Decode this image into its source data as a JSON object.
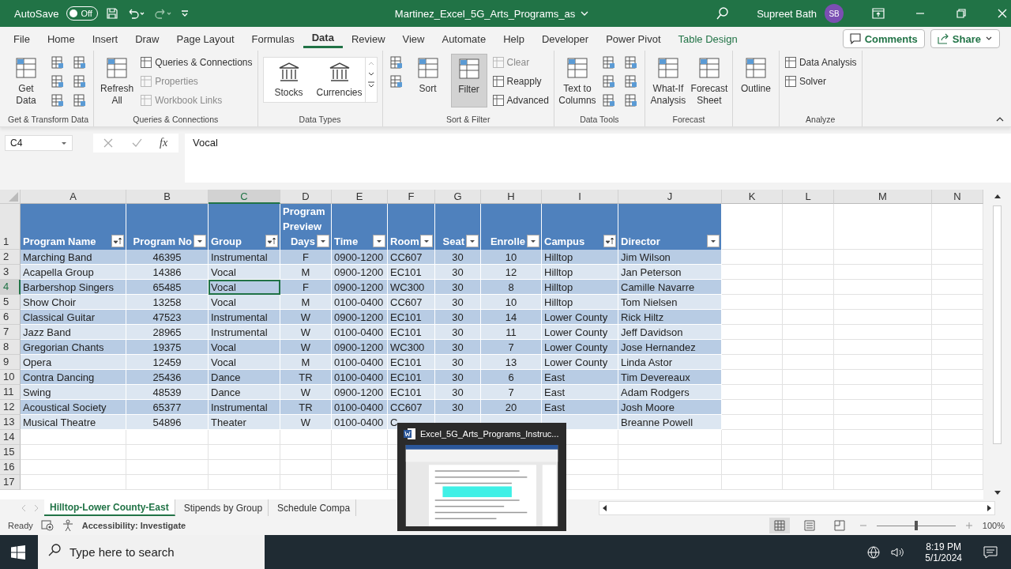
{
  "title_bar": {
    "autosave_label": "AutoSave",
    "autosave": {
      "on": false,
      "label": "Off"
    },
    "document_title": "Martinez_Excel_5G_Arts_Programs_as",
    "user_name": "Supreet Bath",
    "avatar_initials": "SB"
  },
  "ribbon_tabs": [
    {
      "label": "File",
      "selected": false,
      "kind": "plain"
    },
    {
      "label": "Home",
      "selected": false,
      "kind": "plain"
    },
    {
      "label": "Insert",
      "selected": false,
      "kind": "plain"
    },
    {
      "label": "Draw",
      "selected": false,
      "kind": "plain"
    },
    {
      "label": "Page Layout",
      "selected": false,
      "kind": "plain"
    },
    {
      "label": "Formulas",
      "selected": false,
      "kind": "plain"
    },
    {
      "label": "Data",
      "selected": true,
      "kind": "plain"
    },
    {
      "label": "Review",
      "selected": false,
      "kind": "plain"
    },
    {
      "label": "View",
      "selected": false,
      "kind": "plain"
    },
    {
      "label": "Automate",
      "selected": false,
      "kind": "plain"
    },
    {
      "label": "Help",
      "selected": false,
      "kind": "plain"
    },
    {
      "label": "Developer",
      "selected": false,
      "kind": "plain"
    },
    {
      "label": "Power Pivot",
      "selected": false,
      "kind": "plain"
    },
    {
      "label": "Table Design",
      "selected": false,
      "kind": "contextual"
    }
  ],
  "ribbon_buttons": [
    "Comments",
    "Share"
  ],
  "ribbon_groups": [
    {
      "label": "Get & Transform Data",
      "commands": [
        {
          "kind": "large",
          "label": "Get Data",
          "disabled": false,
          "pressed": false
        },
        {
          "kind": "icon",
          "disabled": false,
          "pressed": false
        },
        {
          "kind": "icon",
          "disabled": false,
          "pressed": false
        },
        {
          "kind": "icon",
          "disabled": false,
          "pressed": false
        },
        {
          "kind": "icon",
          "disabled": false,
          "pressed": false
        },
        {
          "kind": "icon",
          "disabled": false,
          "pressed": false
        },
        {
          "kind": "icon",
          "disabled": false,
          "pressed": false
        }
      ]
    },
    {
      "label": "Queries & Connections",
      "commands": [
        {
          "kind": "large",
          "label": "Refresh All",
          "disabled": false,
          "pressed": false
        },
        {
          "kind": "small",
          "label": "Queries & Connections",
          "disabled": false,
          "pressed": false
        },
        {
          "kind": "small",
          "label": "Properties",
          "disabled": true,
          "pressed": false
        },
        {
          "kind": "small",
          "label": "Workbook Links",
          "disabled": true,
          "pressed": false
        }
      ]
    },
    {
      "label": "Data Types",
      "commands": [
        {
          "kind": "gallery",
          "label": "Stocks",
          "disabled": false,
          "pressed": false
        },
        {
          "kind": "gallery",
          "label": "Currencies",
          "disabled": false,
          "pressed": false
        }
      ]
    },
    {
      "label": "Sort & Filter",
      "commands": [
        {
          "kind": "icon",
          "disabled": false,
          "pressed": false
        },
        {
          "kind": "icon",
          "disabled": false,
          "pressed": false
        },
        {
          "kind": "large",
          "label": "Sort",
          "disabled": false,
          "pressed": false
        },
        {
          "kind": "large",
          "label": "Filter",
          "disabled": false,
          "pressed": true
        },
        {
          "kind": "small",
          "label": "Clear",
          "disabled": true,
          "pressed": false
        },
        {
          "kind": "small",
          "label": "Reapply",
          "disabled": false,
          "pressed": false
        },
        {
          "kind": "small",
          "label": "Advanced",
          "disabled": false,
          "pressed": false
        }
      ]
    },
    {
      "label": "Data Tools",
      "commands": [
        {
          "kind": "large",
          "label": "Text to Columns",
          "disabled": false,
          "pressed": false
        },
        {
          "kind": "icon",
          "disabled": false,
          "pressed": false
        },
        {
          "kind": "icon",
          "disabled": false,
          "pressed": false
        },
        {
          "kind": "icon",
          "disabled": false,
          "pressed": false
        },
        {
          "kind": "icon",
          "disabled": false,
          "pressed": false
        },
        {
          "kind": "icon",
          "disabled": false,
          "pressed": false
        },
        {
          "kind": "icon",
          "disabled": false,
          "pressed": false
        }
      ]
    },
    {
      "label": "Forecast",
      "commands": [
        {
          "kind": "large",
          "label": "What-If Analysis",
          "disabled": false,
          "pressed": false
        },
        {
          "kind": "large",
          "label": "Forecast Sheet",
          "disabled": false,
          "pressed": false
        }
      ]
    },
    {
      "commands": [
        {
          "kind": "large",
          "label": "Outline",
          "disabled": false,
          "pressed": false
        }
      ]
    },
    {
      "label": "Analyze",
      "commands": [
        {
          "kind": "small",
          "label": "Data Analysis",
          "disabled": false,
          "pressed": false
        },
        {
          "kind": "small",
          "label": "Solver",
          "disabled": false,
          "pressed": false
        }
      ]
    }
  ],
  "formula_bar": {
    "name_box": "C4",
    "function_label": "fx",
    "value": "Vocal"
  },
  "columns": [
    {
      "letter": "A",
      "title": "Program Name",
      "sorted": true,
      "kind": "text",
      "selected": false
    },
    {
      "letter": "B",
      "title": "Program No",
      "sorted": false,
      "kind": "number",
      "selected": false
    },
    {
      "letter": "C",
      "title": "Group",
      "sorted": true,
      "kind": "text",
      "selected": true
    },
    {
      "letter": "D",
      "title": "Program Preview Days",
      "sorted": false,
      "kind": "number",
      "selected": false
    },
    {
      "letter": "E",
      "title": "Time",
      "sorted": false,
      "kind": "text",
      "selected": false
    },
    {
      "letter": "F",
      "title": "Room",
      "sorted": false,
      "kind": "text",
      "selected": false
    },
    {
      "letter": "G",
      "title": "Seat",
      "sorted": false,
      "kind": "number",
      "selected": false
    },
    {
      "letter": "H",
      "title": "Enrolle",
      "sorted": false,
      "kind": "number",
      "selected": false
    },
    {
      "letter": "I",
      "title": "Campus",
      "sorted": true,
      "kind": "text",
      "selected": false
    },
    {
      "letter": "J",
      "title": "Director",
      "sorted": false,
      "kind": "text",
      "selected": false
    }
  ],
  "extra_columns": [
    "K",
    "L",
    "M",
    "N"
  ],
  "header_row_number": "1",
  "rows": [
    {
      "number": "2",
      "selected": false,
      "cells": [
        "Marching Band",
        "46395",
        "Instrumental",
        "F",
        "0900-1200",
        "CC607",
        "30",
        "10",
        "Hilltop",
        "Jim Wilson"
      ]
    },
    {
      "number": "3",
      "selected": false,
      "cells": [
        "Acapella Group",
        "14386",
        "Vocal",
        "M",
        "0900-1200",
        "EC101",
        "30",
        "12",
        "Hilltop",
        "Jan Peterson"
      ]
    },
    {
      "number": "4",
      "selected": true,
      "cells": [
        "Barbershop Singers",
        "65485",
        "Vocal",
        "F",
        "0900-1200",
        "WC300",
        "30",
        "8",
        "Hilltop",
        "Camille Navarre"
      ]
    },
    {
      "number": "5",
      "selected": false,
      "cells": [
        "Show Choir",
        "13258",
        "Vocal",
        "M",
        "0100-0400",
        "CC607",
        "30",
        "10",
        "Hilltop",
        "Tom Nielsen"
      ]
    },
    {
      "number": "6",
      "selected": false,
      "cells": [
        "Classical Guitar",
        "47523",
        "Instrumental",
        "W",
        "0900-1200",
        "EC101",
        "30",
        "14",
        "Lower County",
        "Rick Hiltz"
      ]
    },
    {
      "number": "7",
      "selected": false,
      "cells": [
        "Jazz Band",
        "28965",
        "Instrumental",
        "W",
        "0100-0400",
        "EC101",
        "30",
        "11",
        "Lower County",
        "Jeff Davidson"
      ]
    },
    {
      "number": "8",
      "selected": false,
      "cells": [
        "Gregorian Chants",
        "19375",
        "Vocal",
        "W",
        "0900-1200",
        "WC300",
        "30",
        "7",
        "Lower County",
        "Jose Hernandez"
      ]
    },
    {
      "number": "9",
      "selected": false,
      "cells": [
        "Opera",
        "12459",
        "Vocal",
        "M",
        "0100-0400",
        "EC101",
        "30",
        "13",
        "Lower County",
        "Linda Astor"
      ]
    },
    {
      "number": "10",
      "selected": false,
      "cells": [
        "Contra Dancing",
        "25436",
        "Dance",
        "TR",
        "0100-0400",
        "EC101",
        "30",
        "6",
        "East",
        "Tim Devereaux"
      ]
    },
    {
      "number": "11",
      "selected": false,
      "cells": [
        "Swing",
        "48539",
        "Dance",
        "W",
        "0900-1200",
        "EC101",
        "30",
        "7",
        "East",
        "Adam Rodgers"
      ]
    },
    {
      "number": "12",
      "selected": false,
      "cells": [
        "Acoustical Society",
        "65377",
        "Instrumental",
        "TR",
        "0100-0400",
        "CC607",
        "30",
        "20",
        "East",
        "Josh Moore"
      ]
    },
    {
      "number": "13",
      "selected": false,
      "cells": [
        "Musical Theatre",
        "54896",
        "Theater",
        "W",
        "0100-0400",
        "C",
        null,
        null,
        null,
        "Breanne Powell"
      ]
    }
  ],
  "empty_rows": [
    "14",
    "15",
    "16",
    "17"
  ],
  "sheet_tabs": [
    {
      "label": "Hilltop-Lower County-East",
      "selected": true
    },
    {
      "label": "Stipends by Group",
      "selected": false
    },
    {
      "label": "Schedule Compa",
      "selected": false
    }
  ],
  "status_bar": {
    "mode": "Ready",
    "accessibility": "Accessibility: Investigate",
    "zoom_slider": {
      "level": 0.5
    },
    "zoom": "100%"
  },
  "preview_popup": {
    "title": "Excel_5G_Arts_Programs_Instruc..."
  },
  "taskbar": {
    "search": {
      "placeholder": "Type here to search"
    },
    "time": "8:19 PM",
    "date": "5/1/2024"
  }
}
